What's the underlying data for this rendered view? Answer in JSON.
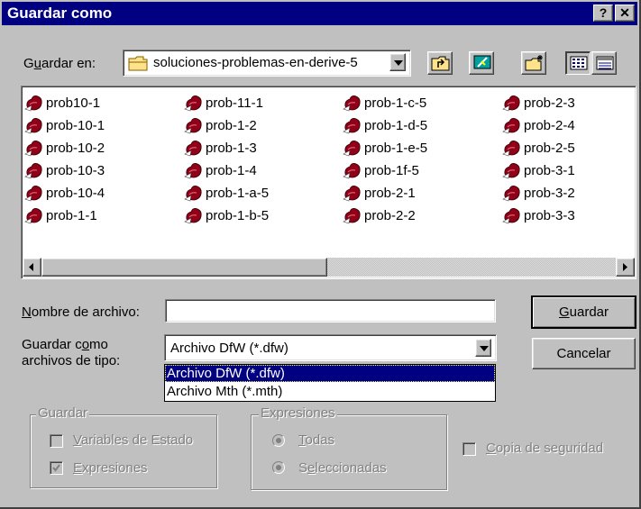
{
  "window": {
    "title": "Guardar como",
    "help_btn": "?",
    "close_btn": "✕"
  },
  "save_in": {
    "label_pre": "G",
    "label_u": "u",
    "label_post": "ardar en:",
    "folder": "soluciones-problemas-en-derive-5"
  },
  "toolbar": [
    "up-folder-icon",
    "desktop-icon",
    "new-folder-icon",
    "list-view-icon",
    "details-view-icon"
  ],
  "files": [
    "prob10-1",
    "prob-10-1",
    "prob-10-2",
    "prob-10-3",
    "prob-10-4",
    "prob-1-1",
    "prob-11-1",
    "prob-1-2",
    "prob-1-3",
    "prob-1-4",
    "prob-1-a-5",
    "prob-1-b-5",
    "prob-1-c-5",
    "prob-1-d-5",
    "prob-1-e-5",
    "prob-1f-5",
    "prob-2-1",
    "prob-2-2",
    "prob-2-3",
    "prob-2-4",
    "prob-2-5",
    "prob-3-1",
    "prob-3-2",
    "prob-3-3"
  ],
  "filename": {
    "label_u": "N",
    "label_post": "ombre de archivo:",
    "value": ""
  },
  "filetype": {
    "label_line1_pre": "Guardar c",
    "label_line1_u": "o",
    "label_line1_post": "mo",
    "label_line2": "archivos de tipo:",
    "value": "Archivo DfW (*.dfw)",
    "options": [
      "Archivo DfW (*.dfw)",
      "Archivo Mth (*.mth)"
    ]
  },
  "buttons": {
    "save_u": "G",
    "save_post": "uardar",
    "cancel": "Cancelar"
  },
  "group_guardar": {
    "title": "Guardar",
    "opt1_u": "V",
    "opt1_post": "ariables de Estado",
    "opt2_u": "E",
    "opt2_post": "xpresiones"
  },
  "group_expresiones": {
    "title": "Expresiones",
    "opt1_u": "T",
    "opt1_post": "odas",
    "opt2_pre": "S",
    "opt2_u": "e",
    "opt2_post": "leccionadas"
  },
  "backup": {
    "label_u": "C",
    "label_post": "opia de seguridad"
  },
  "colors": {
    "title_bar": "#000080",
    "face": "#c0c0c0",
    "selection": "#000080"
  }
}
